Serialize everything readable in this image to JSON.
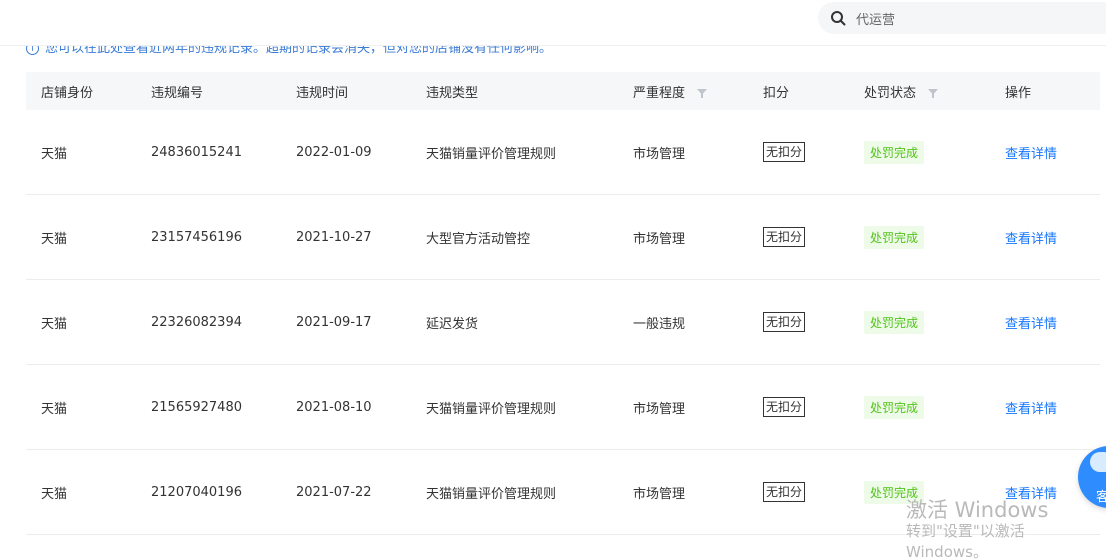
{
  "search": {
    "placeholder": "代运营",
    "icon": "search-icon"
  },
  "info": {
    "text": "您可以在此处查看近两年的违规记录。超期的记录会消失，但对您的店铺没有任何影响。"
  },
  "table": {
    "headers": {
      "shop": "店铺身份",
      "id": "违规编号",
      "time": "违规时间",
      "type": "违规类型",
      "severity": "严重程度",
      "score": "扣分",
      "status": "处罚状态",
      "action": "操作"
    },
    "rows": [
      {
        "shop": "天猫",
        "id": "24836015241",
        "time": "2022-01-09",
        "type": "天猫销量评价管理规则",
        "severity": "市场管理",
        "score": "无扣分",
        "status": "处罚完成",
        "action": "查看详情"
      },
      {
        "shop": "天猫",
        "id": "23157456196",
        "time": "2021-10-27",
        "type": "大型官方活动管控",
        "severity": "市场管理",
        "score": "无扣分",
        "status": "处罚完成",
        "action": "查看详情"
      },
      {
        "shop": "天猫",
        "id": "22326082394",
        "time": "2021-09-17",
        "type": "延迟发货",
        "severity": "一般违规",
        "score": "无扣分",
        "status": "处罚完成",
        "action": "查看详情"
      },
      {
        "shop": "天猫",
        "id": "21565927480",
        "time": "2021-08-10",
        "type": "天猫销量评价管理规则",
        "severity": "市场管理",
        "score": "无扣分",
        "status": "处罚完成",
        "action": "查看详情"
      },
      {
        "shop": "天猫",
        "id": "21207040196",
        "time": "2021-07-22",
        "type": "天猫销量评价管理规则",
        "severity": "市场管理",
        "score": "无扣分",
        "status": "处罚完成",
        "action": "查看详情"
      }
    ]
  },
  "watermark": {
    "line1": "激活 Windows",
    "line2": "转到\"设置\"以激活 Windows。"
  },
  "assistant": {
    "label": "客"
  },
  "colors": {
    "link": "#1677ff",
    "status_green": "#52c41a",
    "status_bg": "#eefbe8",
    "header_bg": "#f6f7f9"
  }
}
